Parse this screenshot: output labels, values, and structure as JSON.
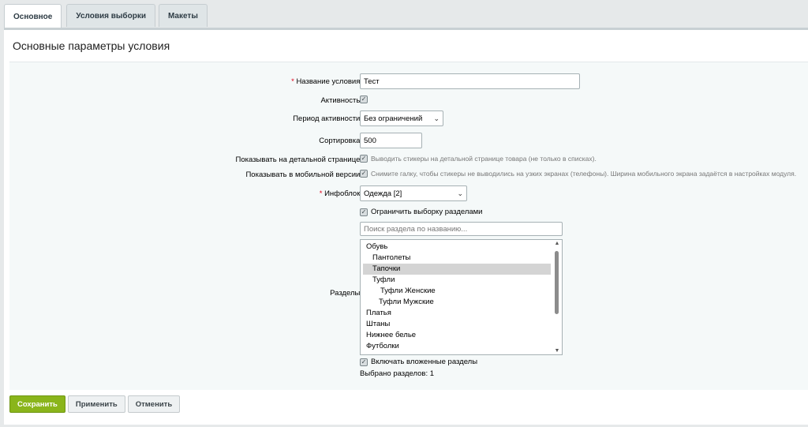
{
  "tabs": [
    "Основное",
    "Условия выборки",
    "Макеты"
  ],
  "section_title": "Основные параметры условия",
  "fields": {
    "name": {
      "label": "Название условия:",
      "value": "Тест"
    },
    "active": {
      "label": "Активность:",
      "checked": true
    },
    "period": {
      "label": "Период активности:",
      "value": "Без ограничений"
    },
    "sort": {
      "label": "Сортировка:",
      "value": "500"
    },
    "detail": {
      "label": "Показывать на детальной странице:",
      "hint": "Выводить стикеры на детальной странице товара (не только в списках)."
    },
    "mobile": {
      "label": "Показывать в мобильной версии:",
      "hint": "Снимите галку, чтобы стикеры не выводились на узких экранах (телефоны). Ширина мобильного экрана задаётся в настройках модуля."
    },
    "iblock": {
      "label": "Инфоблок:",
      "value": "Одежда [2]"
    },
    "limit_sections": {
      "label": "Ограничить выборку разделами"
    },
    "search": {
      "placeholder": "Поиск раздела по названию..."
    },
    "sections": {
      "label": "Разделы:"
    },
    "include_nested": {
      "label": "Включать вложенные разделы"
    },
    "selected_count": "Выбрано разделов: 1"
  },
  "section_items": [
    {
      "label": "Обувь",
      "indent": 0,
      "selected": false
    },
    {
      "label": "Пантолеты",
      "indent": 1,
      "selected": false
    },
    {
      "label": "Тапочки",
      "indent": 1,
      "selected": true
    },
    {
      "label": "Туфли",
      "indent": 1,
      "selected": false
    },
    {
      "label": "Туфли Женские",
      "indent": 2,
      "selected": false
    },
    {
      "label": "Туфли Мужские",
      "indent": 2,
      "selected": false
    },
    {
      "label": "Платья",
      "indent": 0,
      "selected": false
    },
    {
      "label": "Штаны",
      "indent": 0,
      "selected": false
    },
    {
      "label": "Нижнее белье",
      "indent": 0,
      "selected": false
    },
    {
      "label": "Футболки",
      "indent": 0,
      "selected": false
    }
  ],
  "buttons": {
    "save": "Сохранить",
    "apply": "Применить",
    "cancel": "Отменить"
  },
  "colors": {
    "accent": "#8ab51b",
    "required": "#e0001b"
  }
}
